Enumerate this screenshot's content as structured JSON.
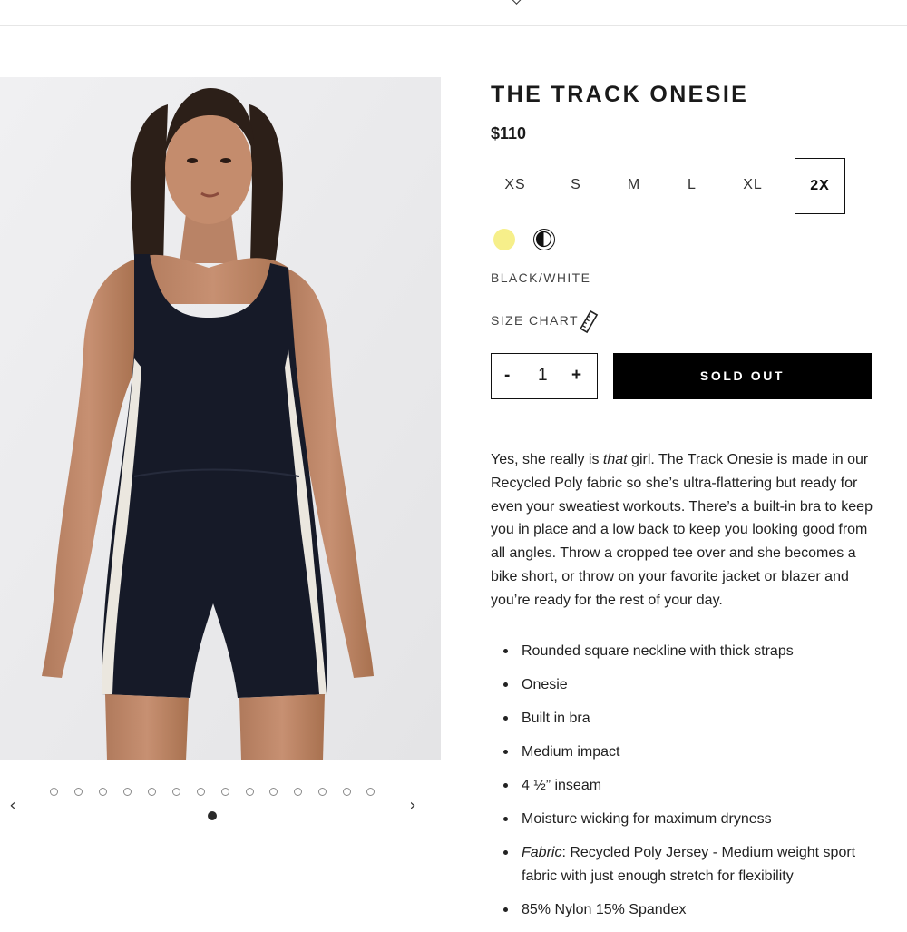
{
  "product": {
    "title": "THE TRACK ONESIE",
    "price": "$110"
  },
  "sizes": [
    "XS",
    "S",
    "M",
    "L",
    "XL",
    "2X"
  ],
  "selected_size": "2X",
  "colors": [
    {
      "name": "yellow",
      "hex": "#f6ef8a"
    },
    {
      "name": "BLACK/WHITE",
      "hex": "#000000"
    }
  ],
  "color_label": "BLACK/WHITE",
  "size_chart": {
    "label": "SIZE CHART",
    "icon": "ruler-icon"
  },
  "quantity": {
    "minus": "-",
    "value": "1",
    "plus": "+"
  },
  "cta": {
    "label": "SOLD OUT",
    "color": "#000000"
  },
  "description": {
    "before": "Yes, she really is ",
    "emphasis": "that",
    "after": " girl. The Track Onesie is made in our Recycled Poly fabric so she’s ultra-flattering but ready for even your sweatiest workouts. There’s a built-in bra to keep you in place and a low back to keep you looking good from all angles. Throw a cropped tee over and she becomes a bike short, or throw on your favorite jacket or blazer and you’re ready for the rest of your day."
  },
  "features": [
    "Rounded square neckline with thick straps",
    "Onesie",
    "Built in bra",
    "Medium impact",
    "4 ½” inseam",
    "Moisture wicking for maximum dryness"
  ],
  "fabric": {
    "label": "Fabric",
    "text": ": Recycled Poly Jersey - Medium weight sport fabric with just enough stretch for flexibility"
  },
  "composition": "85% Nylon 15% Spandex",
  "gallery": {
    "image_count": 14,
    "active_index": 1,
    "prev_icon": "chevron-left-icon",
    "next_icon": "chevron-right-icon"
  }
}
